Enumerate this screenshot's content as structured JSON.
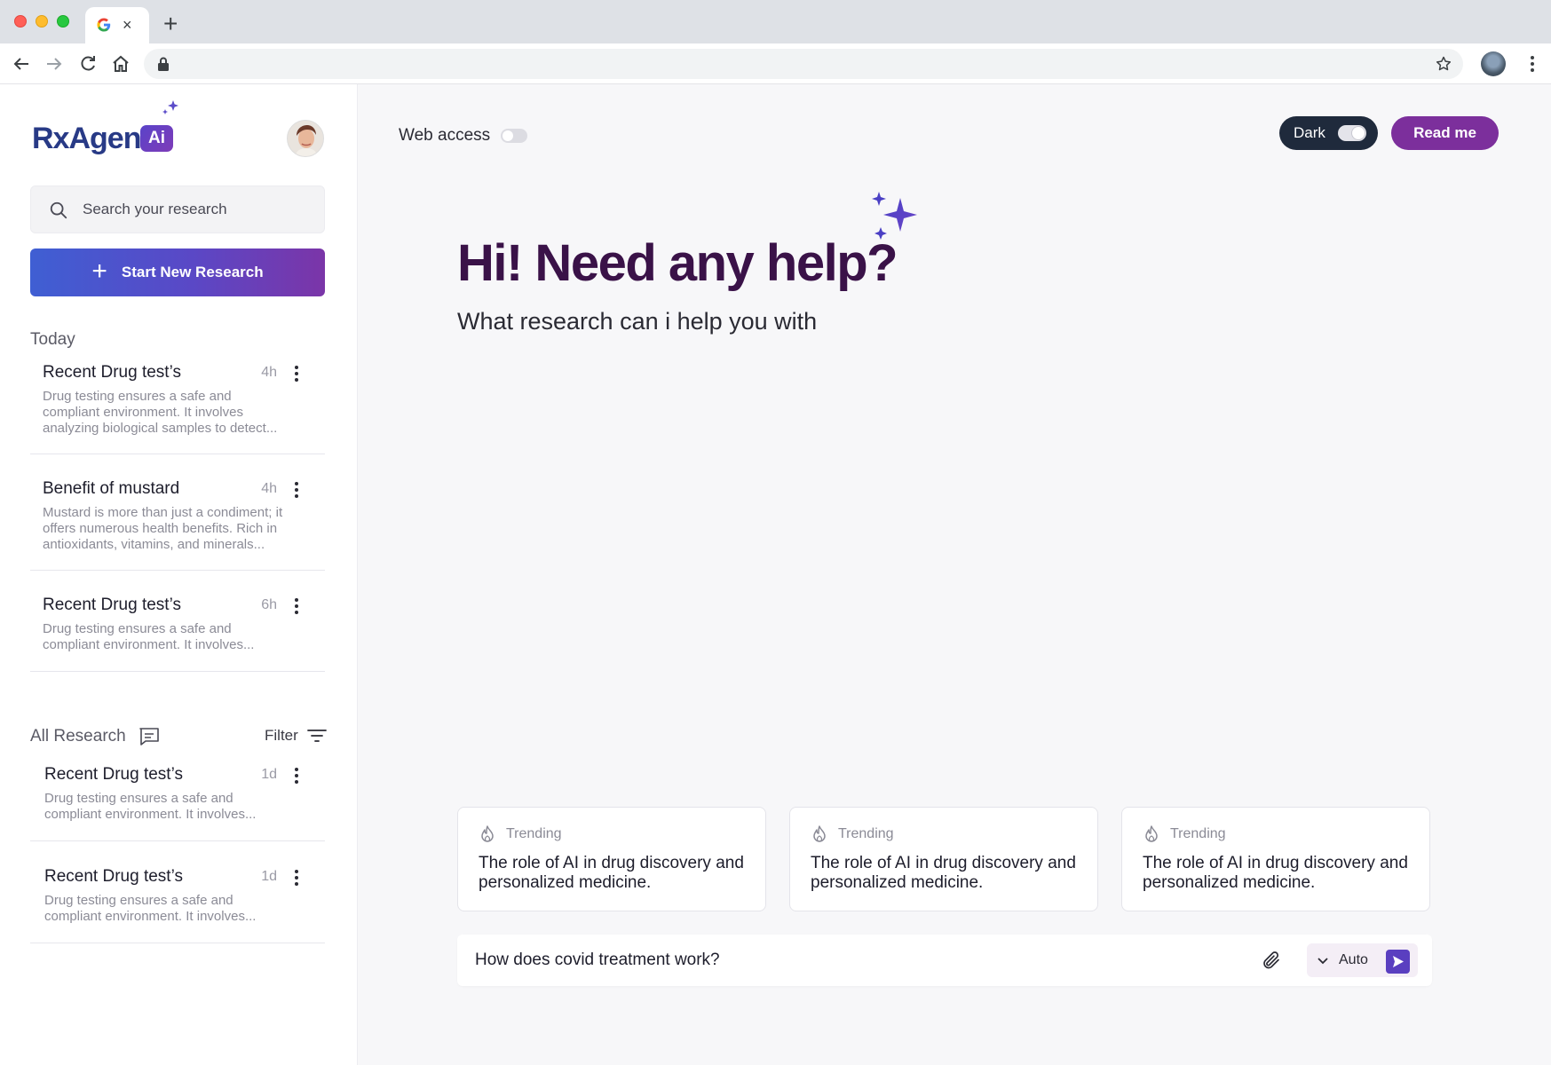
{
  "browser": {
    "tab_close": "×",
    "new_tab": "+"
  },
  "brand": {
    "name": "RxAgent",
    "badge": "Ai"
  },
  "sidebar": {
    "search_placeholder": "Search your research",
    "new_research_label": "Start New Research",
    "today_label": "Today",
    "today_items": [
      {
        "title": "Recent Drug test’s",
        "time": "4h",
        "desc": "Drug testing ensures a safe and compliant environment. It involves analyzing biological samples to detect..."
      },
      {
        "title": "Benefit of mustard",
        "time": "4h",
        "desc": "Mustard is more than just a condiment; it offers numerous health benefits. Rich in antioxidants, vitamins, and minerals..."
      },
      {
        "title": "Recent Drug test’s",
        "time": "6h",
        "desc": "Drug testing ensures a safe and compliant environment. It involves..."
      }
    ],
    "all_research_label": "All Research",
    "filter_label": "Filter",
    "all_items": [
      {
        "title": "Recent Drug test’s",
        "time": "1d",
        "desc": "Drug testing ensures a safe and compliant environment. It involves..."
      },
      {
        "title": "Recent Drug test’s",
        "time": "1d",
        "desc": "Drug testing ensures a safe and compliant environment. It involves..."
      }
    ]
  },
  "header": {
    "web_access_label": "Web access",
    "dark_label": "Dark",
    "readme_label": "Read me"
  },
  "hero": {
    "title": "Hi! Need any help?",
    "subtitle": "What research can i help you with"
  },
  "trending": [
    {
      "tag": "Trending",
      "text": "The role of AI in drug discovery and personalized medicine."
    },
    {
      "tag": "Trending",
      "text": "The role of AI in drug discovery and personalized medicine."
    },
    {
      "tag": "Trending",
      "text": "The role of AI in drug discovery and personalized medicine."
    }
  ],
  "prompt": {
    "value": "How does covid treatment work?",
    "mode_label": "Auto"
  },
  "colors": {
    "brand_dark": "#283a86",
    "accent_purple": "#7c2f9c",
    "hero_title": "#3a1248"
  }
}
